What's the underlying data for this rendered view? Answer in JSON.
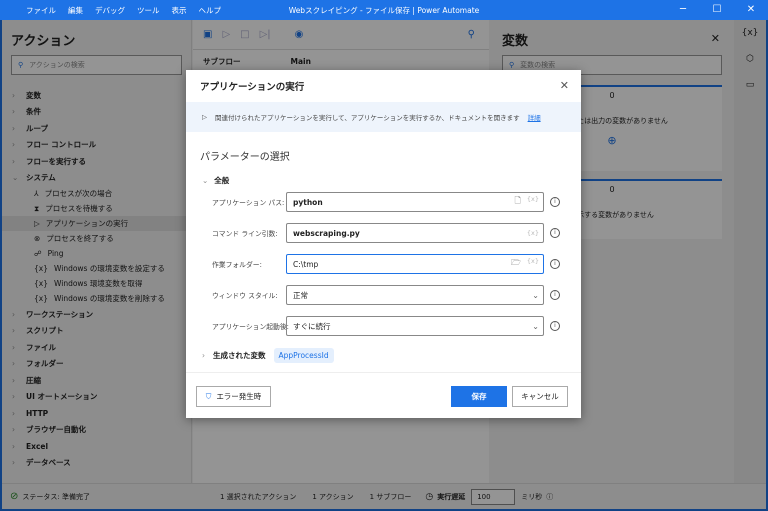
{
  "window": {
    "menu": [
      "ファイル",
      "編集",
      "デバッグ",
      "ツール",
      "表示",
      "ヘルプ"
    ],
    "title": "Webスクレイピング - ファイル保存 | Power Automate"
  },
  "actions": {
    "title": "アクション",
    "search_placeholder": "アクションの検索",
    "top": [
      "変数",
      "条件",
      "ループ",
      "フロー コントロール",
      "フローを実行する"
    ],
    "system": "システム",
    "system_items": [
      "プロセスが次の場合",
      "プロセスを待機する",
      "アプリケーションの実行",
      "プロセスを終了する",
      "Ping",
      "Windows の環境変数を設定する",
      "Windows 環境変数を取得",
      "Windows の環境変数を削除する"
    ],
    "bottom": [
      "ワークステーション",
      "スクリプト",
      "ファイル",
      "フォルダー",
      "圧縮",
      "UI オートメーション",
      "HTTP",
      "ブラウザー自動化",
      "Excel",
      "データベース"
    ]
  },
  "flow": {
    "subflow_label": "サブフロー",
    "tab_main": "Main"
  },
  "variables": {
    "title": "変数",
    "search_placeholder": "変数の検索",
    "count1": "0",
    "empty1": "入力または出力の変数がありません",
    "count2": "0",
    "empty2": "表示する変数がありません"
  },
  "status": {
    "text": "ステータス: 準備完了",
    "selected": "1 選択されたアクション",
    "actions": "1 アクション",
    "subflows": "1 サブフロー",
    "delay_label": "実行遅延",
    "delay_value": "100",
    "unit": "ミリ秒"
  },
  "dialog": {
    "title": "アプリケーションの実行",
    "description": "関連付けられたアプリケーションを実行して、アプリケーションを実行するか、ドキュメントを開きます",
    "details_link": "詳細",
    "params_heading": "パラメーターの選択",
    "group": "全般",
    "fields": [
      {
        "label": "アプリケーション パス:",
        "value": "python"
      },
      {
        "label": "コマンド ライン引数:",
        "value": "webscraping.py"
      },
      {
        "label": "作業フォルダー:",
        "value": "C:\\tmp"
      },
      {
        "label": "ウィンドウ スタイル:",
        "value": "正常"
      },
      {
        "label": "アプリケーション起動後:",
        "value": "すぐに続行"
      }
    ],
    "var_token": "{x}",
    "generated_label": "生成された変数",
    "generated_var": "AppProcessId",
    "on_error": "エラー発生時",
    "save": "保存",
    "cancel": "キャンセル"
  },
  "colors": {
    "accent": "#1e73e6"
  }
}
